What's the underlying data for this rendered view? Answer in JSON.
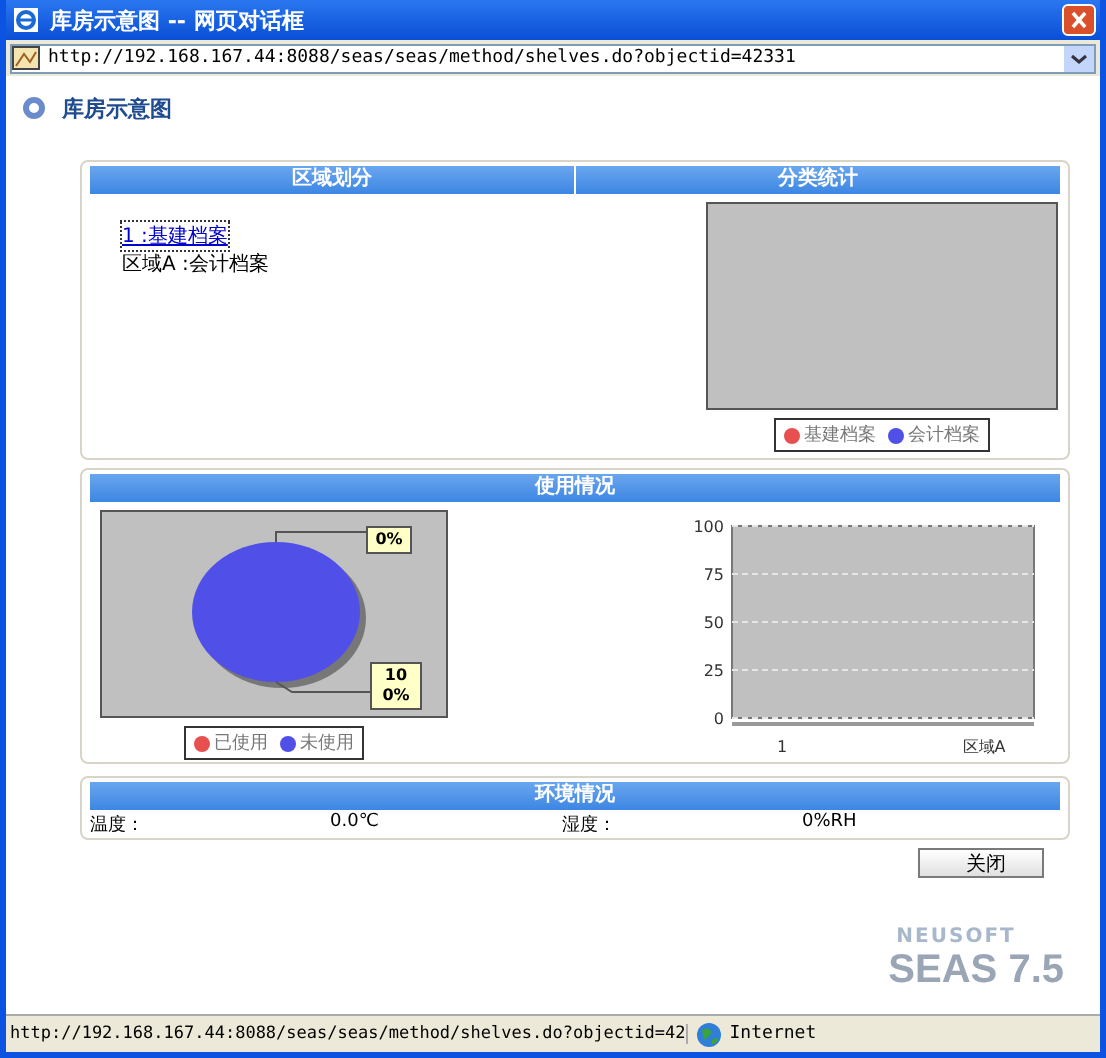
{
  "window": {
    "title": "库房示意图 -- 网页对话框"
  },
  "address_bar": {
    "url": "http://192.168.167.44:8088/seas/seas/method/shelves.do?objectid=42331"
  },
  "page_title": "库房示意图",
  "zone_panel": {
    "headers": [
      "区域划分",
      "分类统计"
    ],
    "zones": [
      {
        "text": "1 :基建档案",
        "kind": "link"
      },
      {
        "text": "区域A :会计档案",
        "kind": "text"
      }
    ],
    "category_legend": [
      {
        "label": "基建档案",
        "color": "#e85050"
      },
      {
        "label": "会计档案",
        "color": "#5050e8"
      }
    ]
  },
  "usage_panel": {
    "title": "使用情况",
    "pie": {
      "chart_data": {
        "type": "pie",
        "categories": [
          "已使用",
          "未使用"
        ],
        "values": [
          0,
          100
        ],
        "colors": [
          "#e85050",
          "#5050e8"
        ],
        "value_labels": [
          "0%",
          "100%"
        ]
      }
    },
    "bar": {
      "chart_data": {
        "type": "bar",
        "categories": [
          "1",
          "区域A"
        ],
        "values": [
          0,
          0
        ],
        "ylim": [
          0,
          100
        ],
        "yticks": [
          0,
          25,
          50,
          75,
          100
        ],
        "grid": true
      }
    }
  },
  "environment": {
    "title": "环境情况",
    "readings": [
      {
        "label": "温度：",
        "value": "0.0℃"
      },
      {
        "label": "湿度：",
        "value": "0%RH"
      }
    ]
  },
  "close_button": "关闭",
  "brand": {
    "company": "NEUSOFT",
    "product": "SEAS 7.5"
  },
  "status_bar": {
    "url": "http://192.168.167.44:8088/seas/seas/method/shelves.do?objectid=42",
    "zone": "Internet"
  }
}
